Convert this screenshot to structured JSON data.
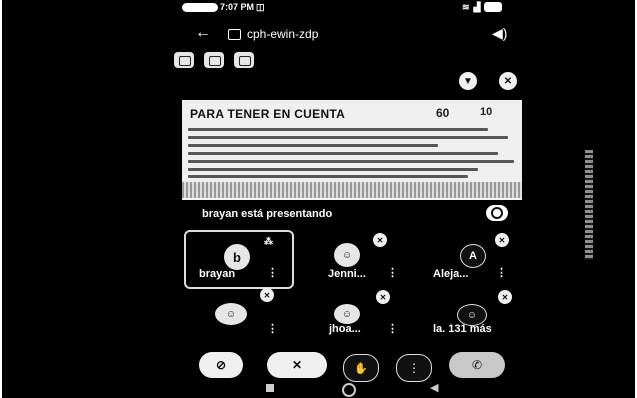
{
  "status_bar": {
    "time": "7:07 PM",
    "icons_left": [
      "battery-pill-icon",
      "cast-icon"
    ],
    "icons_right": [
      "wifi-icon",
      "signal-icon",
      "battery-icon"
    ]
  },
  "header": {
    "back_icon": "arrow-left-icon",
    "meeting_code": "cph-ewin-zdp",
    "volume_icon": "speaker-icon"
  },
  "toolbar": {
    "buttons": [
      "camera-switch-icon",
      "effects-icon",
      "captions-icon"
    ]
  },
  "shared_content": {
    "title": "PARA TENER EN CUENTA",
    "badge_1": "60",
    "badge_2": "10"
  },
  "presenting_label": "brayan está presentando",
  "participants": [
    {
      "name": "brayan",
      "initial": "b",
      "pinned": true
    },
    {
      "name": "Jenni...",
      "initial": ""
    },
    {
      "name": "Aleja...",
      "initial": "A"
    },
    {
      "name": "",
      "initial": ""
    },
    {
      "name": "jhoa...",
      "initial": ""
    },
    {
      "name": "la.  131 más",
      "initial": ""
    }
  ],
  "controls": [
    "camera-off-icon",
    "mic-off-icon",
    "raise-hand-icon",
    "more-options-icon",
    "end-call-icon"
  ],
  "nav": [
    "recents-icon",
    "home-icon",
    "back-nav-icon"
  ],
  "colors": {
    "background": "#000000",
    "ui": "#e8e8e8",
    "end_call": "#c8c8c8"
  }
}
